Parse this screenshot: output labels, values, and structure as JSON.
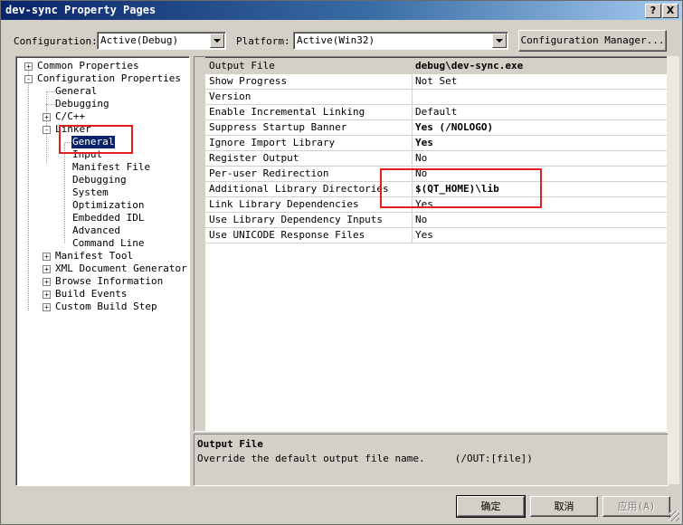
{
  "window": {
    "title": "dev-sync Property Pages",
    "help_glyph": "?",
    "close_glyph": "X"
  },
  "toolbar": {
    "configuration_label": "Configuration:",
    "configuration_value": "Active(Debug)",
    "platform_label": "Platform:",
    "platform_value": "Active(Win32)",
    "config_manager_label": "Configuration Manager..."
  },
  "tree": {
    "expand_plus": "+",
    "expand_minus": "-",
    "items": [
      {
        "label": "Common Properties"
      },
      {
        "label": "Configuration Properties"
      },
      {
        "label": "General"
      },
      {
        "label": "Debugging"
      },
      {
        "label": "C/C++"
      },
      {
        "label": "Linker"
      },
      {
        "label": "General"
      },
      {
        "label": "Input"
      },
      {
        "label": "Manifest File"
      },
      {
        "label": "Debugging"
      },
      {
        "label": "System"
      },
      {
        "label": "Optimization"
      },
      {
        "label": "Embedded IDL"
      },
      {
        "label": "Advanced"
      },
      {
        "label": "Command Line"
      },
      {
        "label": "Manifest Tool"
      },
      {
        "label": "XML Document Generator"
      },
      {
        "label": "Browse Information"
      },
      {
        "label": "Build Events"
      },
      {
        "label": "Custom Build Step"
      }
    ]
  },
  "properties": [
    {
      "name": "Output File",
      "value": "debug\\dev-sync.exe"
    },
    {
      "name": "Show Progress",
      "value": "Not Set"
    },
    {
      "name": "Version",
      "value": ""
    },
    {
      "name": "Enable Incremental Linking",
      "value": "Default"
    },
    {
      "name": "Suppress Startup Banner",
      "value": "Yes (/NOLOGO)"
    },
    {
      "name": "Ignore Import Library",
      "value": "Yes"
    },
    {
      "name": "Register Output",
      "value": "No"
    },
    {
      "name": "Per-user Redirection",
      "value": "No"
    },
    {
      "name": "Additional Library Directories",
      "value": "$(QT_HOME)\\lib"
    },
    {
      "name": "Link Library Dependencies",
      "value": "Yes"
    },
    {
      "name": "Use Library Dependency Inputs",
      "value": "No"
    },
    {
      "name": "Use UNICODE Response Files",
      "value": "Yes"
    }
  ],
  "description": {
    "title": "Output File",
    "text": "Override the default output file name.     (/OUT:[file])"
  },
  "buttons": {
    "ok": "确定",
    "cancel": "取消",
    "apply": "应用(A)"
  },
  "colors": {
    "title_start": "#0a246a",
    "title_end": "#a6caf0",
    "annotation": "#e02020",
    "selection": "#0a246a"
  }
}
